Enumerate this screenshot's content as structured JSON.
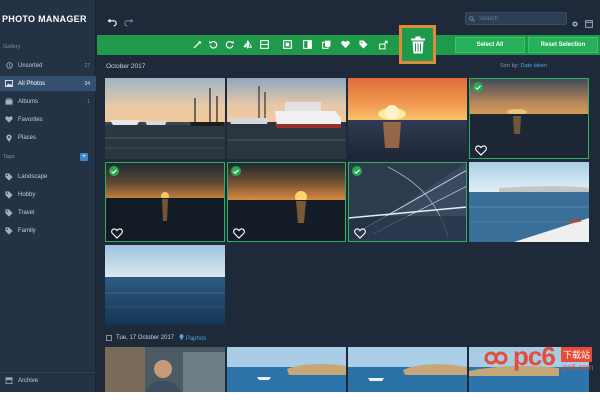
{
  "app": {
    "title": "PHOTO MANAGER"
  },
  "sidebar": {
    "gallery_label": "Gallery",
    "items": [
      {
        "label": "Unsorted",
        "count": "27",
        "icon": "clock-icon"
      },
      {
        "label": "All Photos",
        "count": "34",
        "icon": "photos-icon",
        "active": true
      },
      {
        "label": "Albums",
        "count": "1",
        "icon": "albums-icon"
      },
      {
        "label": "Favorites",
        "count": "",
        "icon": "heart-icon"
      },
      {
        "label": "Places",
        "count": "",
        "icon": "pin-icon"
      }
    ],
    "tags_label": "Tags",
    "tags_add": "+",
    "tags": [
      {
        "label": "Landscape",
        "icon": "tag-icon"
      },
      {
        "label": "Hobby",
        "icon": "tag-icon"
      },
      {
        "label": "Travel",
        "icon": "tag-icon"
      },
      {
        "label": "Family",
        "icon": "tag-icon"
      }
    ],
    "archive_label": "Archive"
  },
  "topbar": {
    "search_placeholder": "Search"
  },
  "toolbar": {
    "select_all": "Select All",
    "reset_selection": "Reset Selection",
    "icons": [
      "magic-wand-icon",
      "rotate-left-icon",
      "rotate-right-icon",
      "flip-horizontal-icon",
      "flip-vertical-icon",
      "crop-icon",
      "adjust-icon",
      "compare-icon",
      "favorite-icon",
      "tag-icon",
      "share-icon",
      "delete-icon"
    ]
  },
  "content": {
    "section1_date": "October 2017",
    "sort_label": "Sort by:",
    "sort_value": "Date taken",
    "section2_date": "Tue, 17 October 2017",
    "section2_location": "Paphos"
  },
  "watermark": {
    "logo": "pc6",
    "site": "下载站",
    "url": "pc6.com"
  },
  "colors": {
    "accent_green": "#1f9a4a",
    "highlight_orange": "#e0893d",
    "link_blue": "#4aa3e0"
  }
}
